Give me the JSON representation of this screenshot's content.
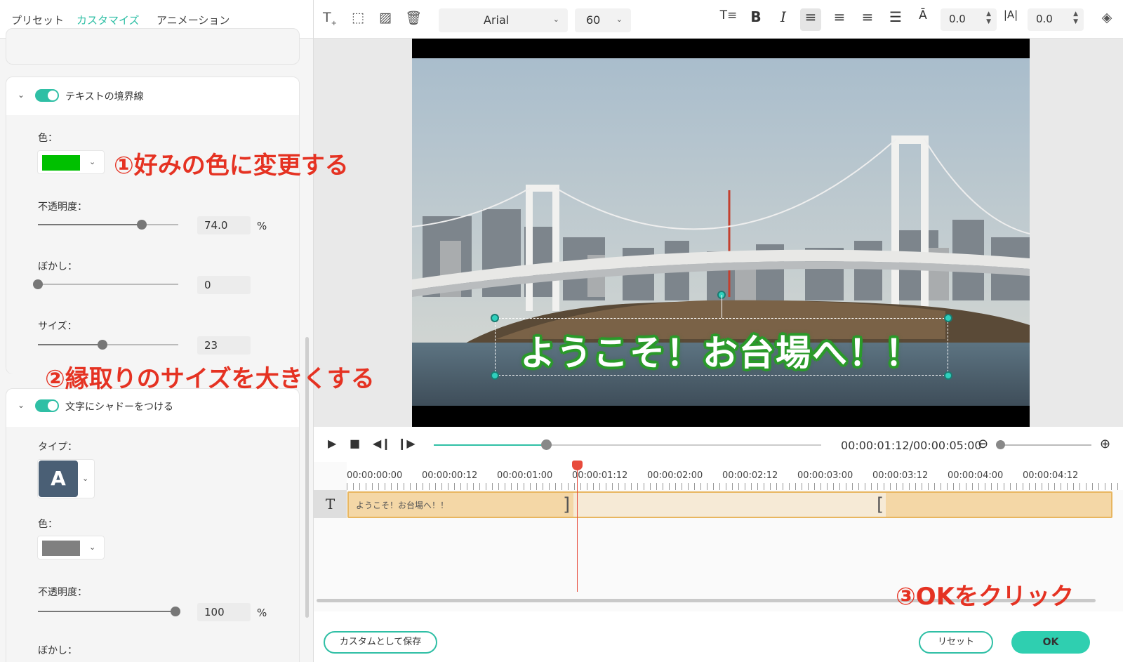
{
  "tabs": [
    "プリセット",
    "カスタマイズ",
    "アニメーション"
  ],
  "border_section": {
    "title": "テキストの境界線",
    "color_label": "色：",
    "color": "#00c000",
    "opacity_label": "不透明度：",
    "opacity_value": "74.0",
    "opacity_fraction": 0.74,
    "opacity_unit": "%",
    "blur_label": "ぼかし：",
    "blur_value": "0",
    "blur_fraction": 0,
    "size_label": "サイズ：",
    "size_value": "23",
    "size_fraction": 0.46
  },
  "shadow_section": {
    "title": "文字にシャドーをつける",
    "type_label": "タイプ：",
    "type_glyph": "A",
    "color_label": "色：",
    "color": "#808080",
    "opacity_label": "不透明度：",
    "opacity_value": "100",
    "opacity_fraction": 0.98,
    "opacity_unit": "%",
    "blur_label": "ぼかし："
  },
  "toolbar": {
    "font": "Arial",
    "font_size": "60",
    "line_spacing": "0.0",
    "char_spacing": "0.0",
    "bold": "B",
    "italic": "I",
    "char_spacing_icon": "|A|"
  },
  "preview": {
    "overlay_text": "ようこそ！お台場へ！！"
  },
  "playback": {
    "timecode": "00:00:01:12/00:00:05:00",
    "progress_fraction": 0.29,
    "zoom_fraction": 0.0
  },
  "timeline": {
    "track_icon": "T",
    "ticks": [
      "00:00:00:00",
      "00:00:00:12",
      "00:00:01:00",
      "00:00:01:12",
      "00:00:02:00",
      "00:00:02:12",
      "00:00:03:00",
      "00:00:03:12",
      "00:00:04:00",
      "00:00:04:12"
    ],
    "clip_text": "ようこそ！お台場へ！！"
  },
  "footer": {
    "save_custom": "カスタムとして保存",
    "reset": "リセット",
    "ok": "OK"
  },
  "annotations": {
    "step1": "①好みの色に変更する",
    "step2": "②縁取りのサイズを大きくする",
    "step3": "③OKをクリック"
  },
  "colors": {
    "accent": "#2fbfa5",
    "annotation": "#e53222",
    "outline": "#2a9a2a"
  }
}
